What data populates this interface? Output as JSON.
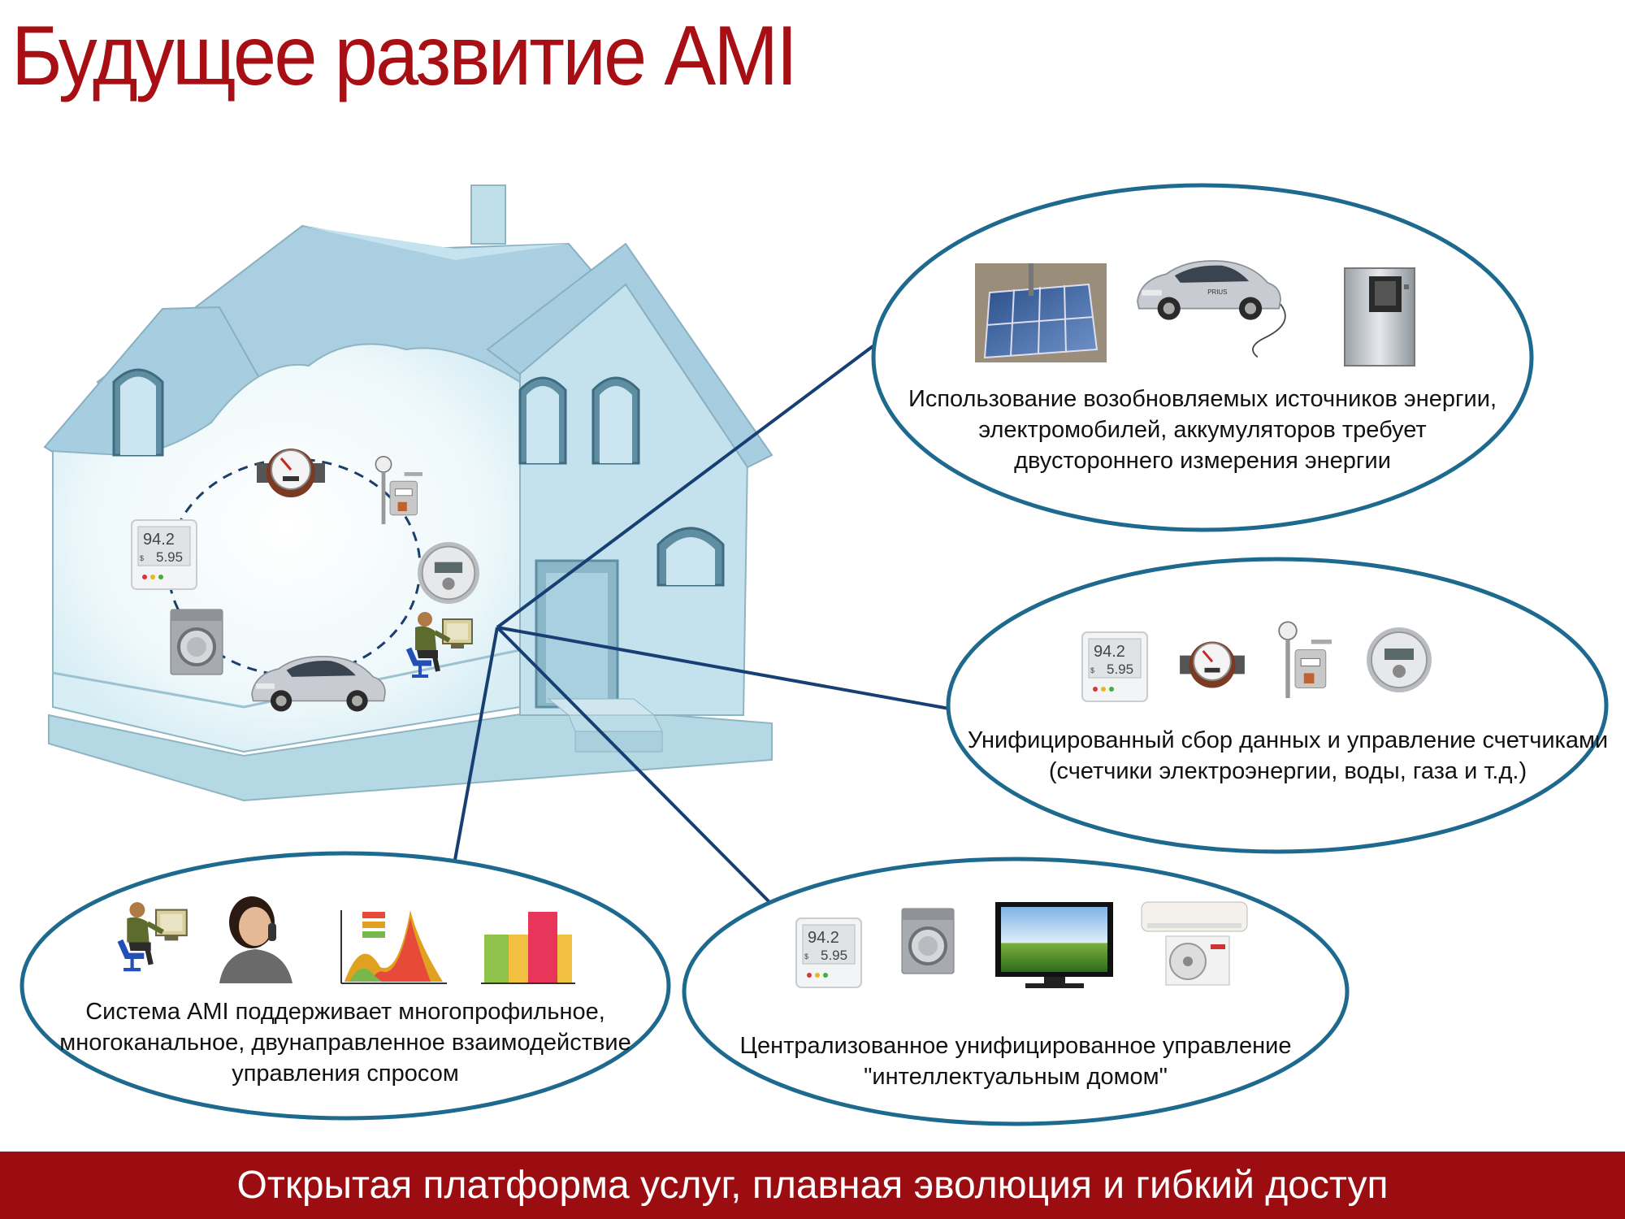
{
  "title": "Будущее развитие AMI",
  "bubbles": {
    "renewables": {
      "lines": [
        "Использование возобновляемых источников энергии,",
        "электромобилей, аккумуляторов требует",
        "двустороннего измерения энергии"
      ]
    },
    "meters": {
      "lines": [
        "Унифицированный сбор данных и управление счетчиками",
        "(счетчики электроэнергии, воды, газа и т.д.)"
      ]
    },
    "smart_home": {
      "lines": [
        "Централизованное унифицированное управление",
        "\"интеллектуальным домом\""
      ]
    },
    "demand": {
      "lines": [
        "Система AMI поддерживает многопрофильное,",
        "многоканальное, двунаправленное взаимодействие",
        "управления спросом"
      ]
    }
  },
  "display_meter": {
    "reading": "94.2",
    "cost": "5.95",
    "currency": "$"
  },
  "car_badge": "PRIUS",
  "colors": {
    "title": "#a80f14",
    "footer": "#9b0d10",
    "ellipse": "#1e6a8f",
    "connector": "#173f73",
    "house": "#c7e4ee"
  },
  "footer": "Открытая платформа услуг, плавная эволюция и гибкий доступ"
}
